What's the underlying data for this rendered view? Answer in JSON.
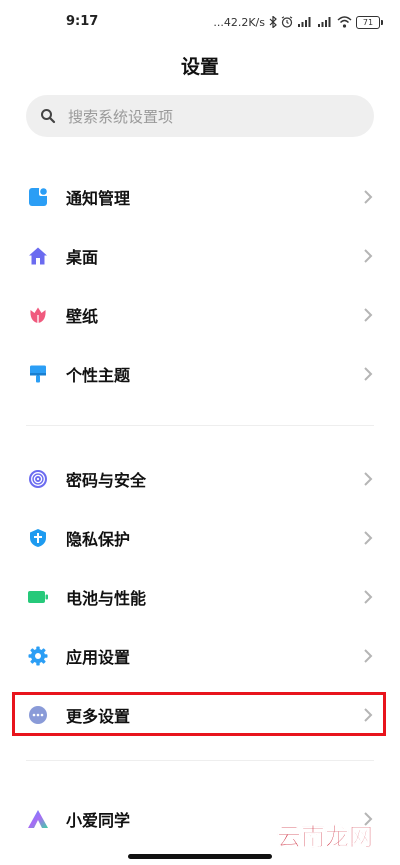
{
  "status_bar": {
    "time": "9:17",
    "network_speed": "...42.2K/s",
    "battery_level": "71"
  },
  "header": {
    "title": "设置"
  },
  "search": {
    "placeholder": "搜索系统设置项"
  },
  "sections": [
    {
      "items": [
        {
          "label": "通知管理",
          "icon": "notification-icon",
          "color": "#2b9ef5"
        },
        {
          "label": "桌面",
          "icon": "home-icon",
          "color": "#6b6bf0"
        },
        {
          "label": "壁纸",
          "icon": "tulip-icon",
          "color": "#f05a7e"
        },
        {
          "label": "个性主题",
          "icon": "brush-icon",
          "color": "#2b9ef5"
        }
      ]
    },
    {
      "items": [
        {
          "label": "密码与安全",
          "icon": "fingerprint-icon",
          "color": "#6b6bf0"
        },
        {
          "label": "隐私保护",
          "icon": "shield-icon",
          "color": "#1e9bf0"
        },
        {
          "label": "电池与性能",
          "icon": "battery-icon",
          "color": "#26c97a"
        },
        {
          "label": "应用设置",
          "icon": "gear-icon",
          "color": "#2b9ef5"
        },
        {
          "label": "更多设置",
          "icon": "more-icon",
          "color": "#8a9bd8"
        }
      ]
    },
    {
      "items": [
        {
          "label": "小爱同学",
          "icon": "xiaoai-icon",
          "color": "#4a7df0"
        }
      ]
    }
  ],
  "highlight_color": "#e8141c",
  "watermark": {
    "text": "云南龙网"
  }
}
